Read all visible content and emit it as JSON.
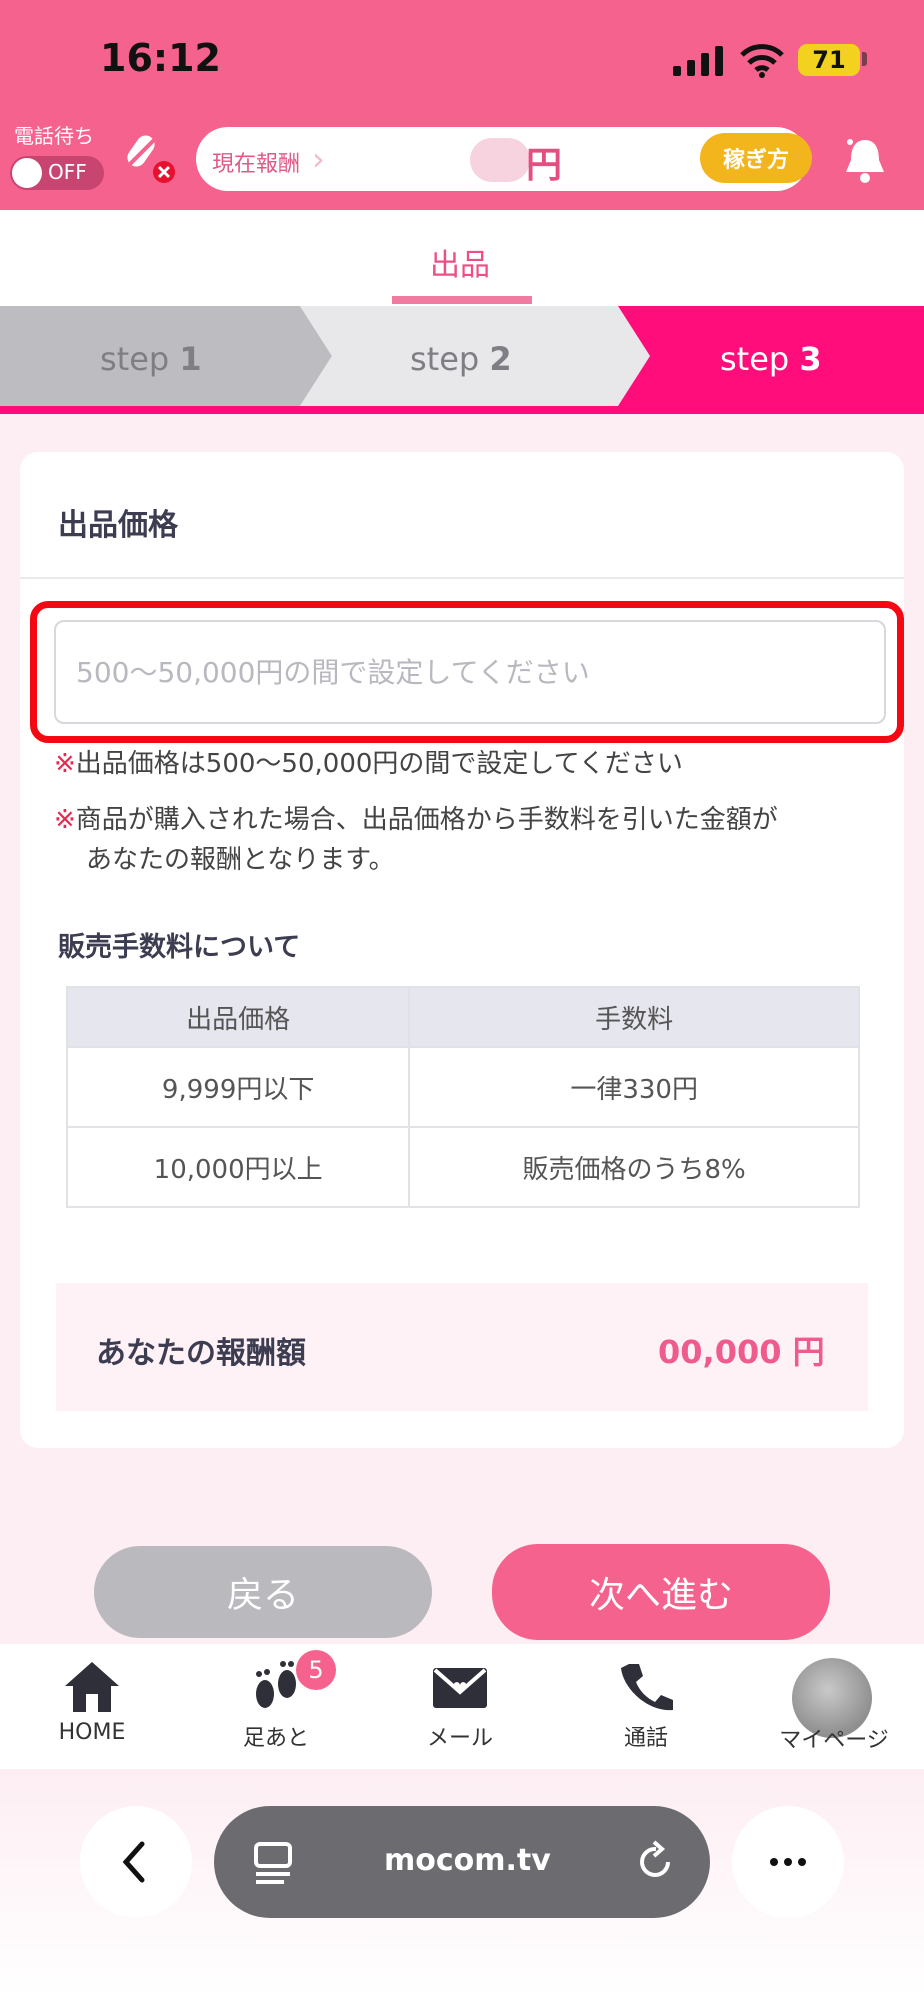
{
  "status_bar": {
    "time": "16:12",
    "battery": "71"
  },
  "header": {
    "call_wait_label": "電話待ち",
    "toggle_label": "OFF",
    "reward_label": "現在報酬",
    "reward_unit": "円",
    "earn_button": "稼ぎ方"
  },
  "page": {
    "title": "出品"
  },
  "steps": [
    {
      "label": "step",
      "num": "1"
    },
    {
      "label": "step",
      "num": "2"
    },
    {
      "label": "step",
      "num": "3"
    }
  ],
  "card": {
    "title": "出品価格",
    "input_placeholder": "500〜50,000円の間で設定してください",
    "note_mark": "※",
    "note1": "出品価格は500〜50,000円の間で設定してください",
    "note2_line1": "商品が購入された場合、出品価格から手数料を引いた金額が",
    "note2_line2": "あなたの報酬となります。",
    "fee_heading": "販売手数料について",
    "table": {
      "headers": [
        "出品価格",
        "手数料"
      ],
      "rows": [
        [
          "9,999円以下",
          "一律330円"
        ],
        [
          "10,000円以上",
          "販売価格のうち8%"
        ]
      ]
    },
    "reward_label": "あなたの報酬額",
    "reward_value": "00,000 円"
  },
  "buttons": {
    "back": "戻る",
    "next": "次へ進む"
  },
  "nav": [
    {
      "label": "HOME",
      "icon": "home-icon"
    },
    {
      "label": "足あと",
      "icon": "footprints-icon",
      "badge": "5"
    },
    {
      "label": "メール",
      "icon": "mail-icon"
    },
    {
      "label": "通話",
      "icon": "phone-icon"
    },
    {
      "label": "マイページ",
      "icon": "avatar"
    }
  ],
  "browser": {
    "url": "mocom.tv"
  },
  "colors": {
    "brand_pink": "#f5628e",
    "step_active": "#ff0d7a",
    "highlight_red": "#f30814",
    "earn_yellow": "#f2b51c"
  }
}
